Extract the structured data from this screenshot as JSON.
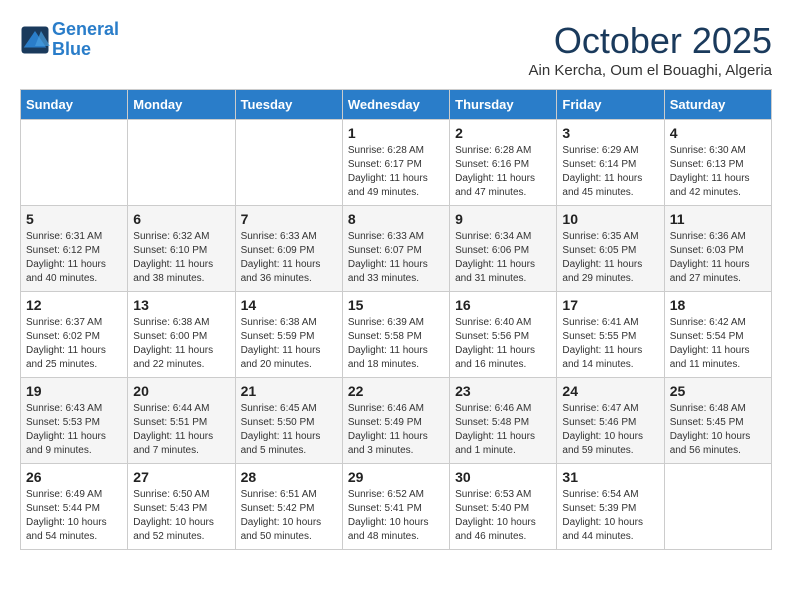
{
  "header": {
    "logo_line1": "General",
    "logo_line2": "Blue",
    "month": "October 2025",
    "location": "Ain Kercha, Oum el Bouaghi, Algeria"
  },
  "days_of_week": [
    "Sunday",
    "Monday",
    "Tuesday",
    "Wednesday",
    "Thursday",
    "Friday",
    "Saturday"
  ],
  "weeks": [
    [
      {
        "day": "",
        "info": ""
      },
      {
        "day": "",
        "info": ""
      },
      {
        "day": "",
        "info": ""
      },
      {
        "day": "1",
        "info": "Sunrise: 6:28 AM\nSunset: 6:17 PM\nDaylight: 11 hours\nand 49 minutes."
      },
      {
        "day": "2",
        "info": "Sunrise: 6:28 AM\nSunset: 6:16 PM\nDaylight: 11 hours\nand 47 minutes."
      },
      {
        "day": "3",
        "info": "Sunrise: 6:29 AM\nSunset: 6:14 PM\nDaylight: 11 hours\nand 45 minutes."
      },
      {
        "day": "4",
        "info": "Sunrise: 6:30 AM\nSunset: 6:13 PM\nDaylight: 11 hours\nand 42 minutes."
      }
    ],
    [
      {
        "day": "5",
        "info": "Sunrise: 6:31 AM\nSunset: 6:12 PM\nDaylight: 11 hours\nand 40 minutes."
      },
      {
        "day": "6",
        "info": "Sunrise: 6:32 AM\nSunset: 6:10 PM\nDaylight: 11 hours\nand 38 minutes."
      },
      {
        "day": "7",
        "info": "Sunrise: 6:33 AM\nSunset: 6:09 PM\nDaylight: 11 hours\nand 36 minutes."
      },
      {
        "day": "8",
        "info": "Sunrise: 6:33 AM\nSunset: 6:07 PM\nDaylight: 11 hours\nand 33 minutes."
      },
      {
        "day": "9",
        "info": "Sunrise: 6:34 AM\nSunset: 6:06 PM\nDaylight: 11 hours\nand 31 minutes."
      },
      {
        "day": "10",
        "info": "Sunrise: 6:35 AM\nSunset: 6:05 PM\nDaylight: 11 hours\nand 29 minutes."
      },
      {
        "day": "11",
        "info": "Sunrise: 6:36 AM\nSunset: 6:03 PM\nDaylight: 11 hours\nand 27 minutes."
      }
    ],
    [
      {
        "day": "12",
        "info": "Sunrise: 6:37 AM\nSunset: 6:02 PM\nDaylight: 11 hours\nand 25 minutes."
      },
      {
        "day": "13",
        "info": "Sunrise: 6:38 AM\nSunset: 6:00 PM\nDaylight: 11 hours\nand 22 minutes."
      },
      {
        "day": "14",
        "info": "Sunrise: 6:38 AM\nSunset: 5:59 PM\nDaylight: 11 hours\nand 20 minutes."
      },
      {
        "day": "15",
        "info": "Sunrise: 6:39 AM\nSunset: 5:58 PM\nDaylight: 11 hours\nand 18 minutes."
      },
      {
        "day": "16",
        "info": "Sunrise: 6:40 AM\nSunset: 5:56 PM\nDaylight: 11 hours\nand 16 minutes."
      },
      {
        "day": "17",
        "info": "Sunrise: 6:41 AM\nSunset: 5:55 PM\nDaylight: 11 hours\nand 14 minutes."
      },
      {
        "day": "18",
        "info": "Sunrise: 6:42 AM\nSunset: 5:54 PM\nDaylight: 11 hours\nand 11 minutes."
      }
    ],
    [
      {
        "day": "19",
        "info": "Sunrise: 6:43 AM\nSunset: 5:53 PM\nDaylight: 11 hours\nand 9 minutes."
      },
      {
        "day": "20",
        "info": "Sunrise: 6:44 AM\nSunset: 5:51 PM\nDaylight: 11 hours\nand 7 minutes."
      },
      {
        "day": "21",
        "info": "Sunrise: 6:45 AM\nSunset: 5:50 PM\nDaylight: 11 hours\nand 5 minutes."
      },
      {
        "day": "22",
        "info": "Sunrise: 6:46 AM\nSunset: 5:49 PM\nDaylight: 11 hours\nand 3 minutes."
      },
      {
        "day": "23",
        "info": "Sunrise: 6:46 AM\nSunset: 5:48 PM\nDaylight: 11 hours\nand 1 minute."
      },
      {
        "day": "24",
        "info": "Sunrise: 6:47 AM\nSunset: 5:46 PM\nDaylight: 10 hours\nand 59 minutes."
      },
      {
        "day": "25",
        "info": "Sunrise: 6:48 AM\nSunset: 5:45 PM\nDaylight: 10 hours\nand 56 minutes."
      }
    ],
    [
      {
        "day": "26",
        "info": "Sunrise: 6:49 AM\nSunset: 5:44 PM\nDaylight: 10 hours\nand 54 minutes."
      },
      {
        "day": "27",
        "info": "Sunrise: 6:50 AM\nSunset: 5:43 PM\nDaylight: 10 hours\nand 52 minutes."
      },
      {
        "day": "28",
        "info": "Sunrise: 6:51 AM\nSunset: 5:42 PM\nDaylight: 10 hours\nand 50 minutes."
      },
      {
        "day": "29",
        "info": "Sunrise: 6:52 AM\nSunset: 5:41 PM\nDaylight: 10 hours\nand 48 minutes."
      },
      {
        "day": "30",
        "info": "Sunrise: 6:53 AM\nSunset: 5:40 PM\nDaylight: 10 hours\nand 46 minutes."
      },
      {
        "day": "31",
        "info": "Sunrise: 6:54 AM\nSunset: 5:39 PM\nDaylight: 10 hours\nand 44 minutes."
      },
      {
        "day": "",
        "info": ""
      }
    ]
  ]
}
